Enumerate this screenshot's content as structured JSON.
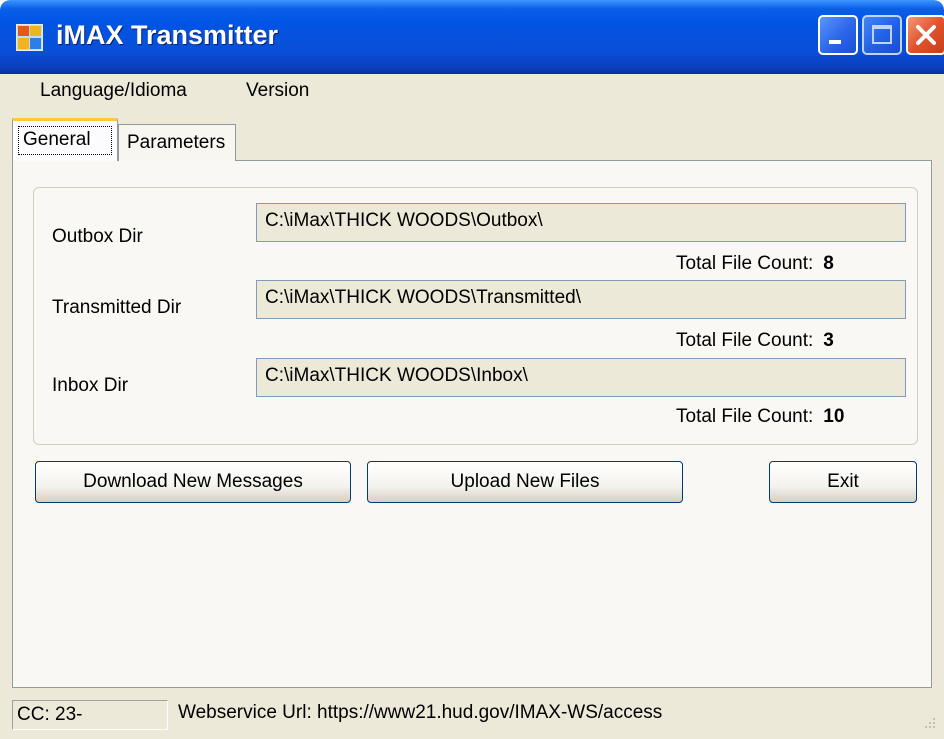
{
  "window": {
    "title": "iMAX Transmitter"
  },
  "menu": {
    "items": [
      "Language/Idioma",
      "Version"
    ]
  },
  "tabs": [
    "General",
    "Parameters"
  ],
  "general": {
    "outbox": {
      "label": "Outbox Dir",
      "path": "C:\\iMax\\THICK WOODS\\Outbox\\",
      "count_label": "Total File Count:",
      "count": "8"
    },
    "transmitted": {
      "label": "Transmitted Dir",
      "path": "C:\\iMax\\THICK WOODS\\Transmitted\\",
      "count_label": "Total File Count:",
      "count": "3"
    },
    "inbox": {
      "label": "Inbox Dir",
      "path": "C:\\iMax\\THICK WOODS\\Inbox\\",
      "count_label": "Total File Count:",
      "count": "10"
    }
  },
  "buttons": {
    "download": "Download New Messages",
    "upload": "Upload New Files",
    "exit": "Exit"
  },
  "status": {
    "cc": "CC: 23-",
    "webservice": "Webservice Url: https://www21.hud.gov/IMAX-WS/access"
  },
  "icons": {
    "app": "app-window-icon",
    "minimize": "minimize-icon",
    "maximize": "maximize-icon",
    "close": "close-icon",
    "grip": "resize-grip-icon"
  },
  "colors": {
    "titlebar": "#0054e3",
    "window_bg": "#ece9d8",
    "close_button": "#e2532c",
    "tab_highlight": "#ffc73c"
  }
}
